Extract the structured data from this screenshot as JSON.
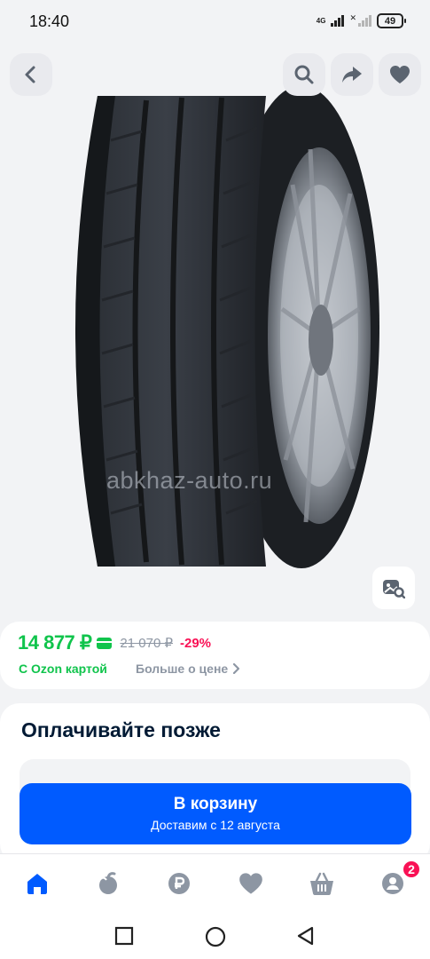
{
  "status_bar": {
    "time": "18:40",
    "network": "4G",
    "battery": "49"
  },
  "header_actions": {
    "back_icon": "chevron-left-icon",
    "search_icon": "search-icon",
    "share_icon": "share-arrow-icon",
    "favorite_icon": "heart-icon"
  },
  "product_image": {
    "watermark": "abkhaz-auto.ru",
    "similar_icon": "similar-search-icon"
  },
  "price": {
    "current": "14 877 ₽",
    "old": "21 070 ₽",
    "discount": "-29%",
    "ozon_card": "С Ozon картой",
    "more_price": "Больше о цене"
  },
  "pay_later": {
    "title": "Оплачивайте позже"
  },
  "cart": {
    "label": "В корзину",
    "delivery": "Доставим с 12 августа"
  },
  "bottom_nav": {
    "items": [
      {
        "icon": "home-icon",
        "active": true
      },
      {
        "icon": "fresh-apple-icon",
        "active": false
      },
      {
        "icon": "ruble-icon",
        "active": false
      },
      {
        "icon": "heart-icon",
        "active": false
      },
      {
        "icon": "cart-basket-icon",
        "active": false
      },
      {
        "icon": "profile-icon",
        "active": false
      }
    ],
    "profile_badge": "2"
  },
  "colors": {
    "accent_blue": "#005bff",
    "price_green": "#10c44c",
    "discount_red": "#f91155",
    "nav_inactive": "#8d96a3"
  }
}
